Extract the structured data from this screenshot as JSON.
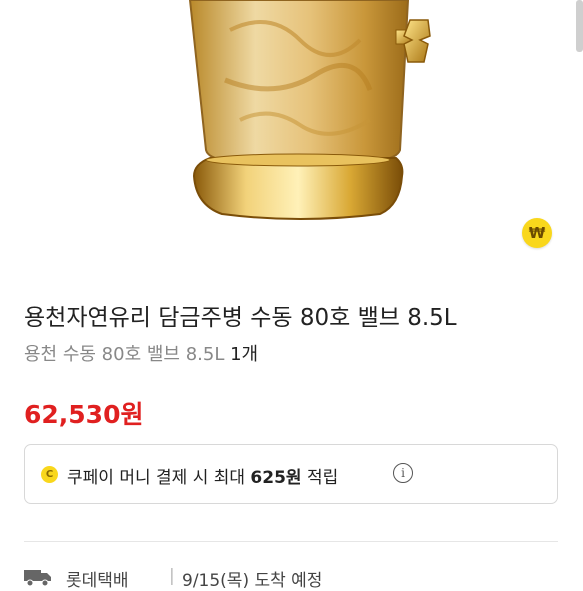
{
  "product": {
    "title": "용천자연유리 담금주병 수동 80호 밸브 8.5L",
    "option_name": "용천 수동 80호 밸브 8.5L",
    "quantity": "1개",
    "price": "62,530원"
  },
  "badge": {
    "symbol": "₩"
  },
  "promo": {
    "coin_symbol": "C",
    "text_before": "쿠페이 머니 결제 시 최대 ",
    "amount": "625원",
    "text_after": " 적립",
    "info_symbol": "i"
  },
  "delivery": {
    "carrier": "롯데택배",
    "separator": "|",
    "eta": "9/15(목) 도착 예정"
  },
  "colors": {
    "price": "#e02020",
    "coin": "#f9d71c",
    "gold": "#d4a02a"
  }
}
